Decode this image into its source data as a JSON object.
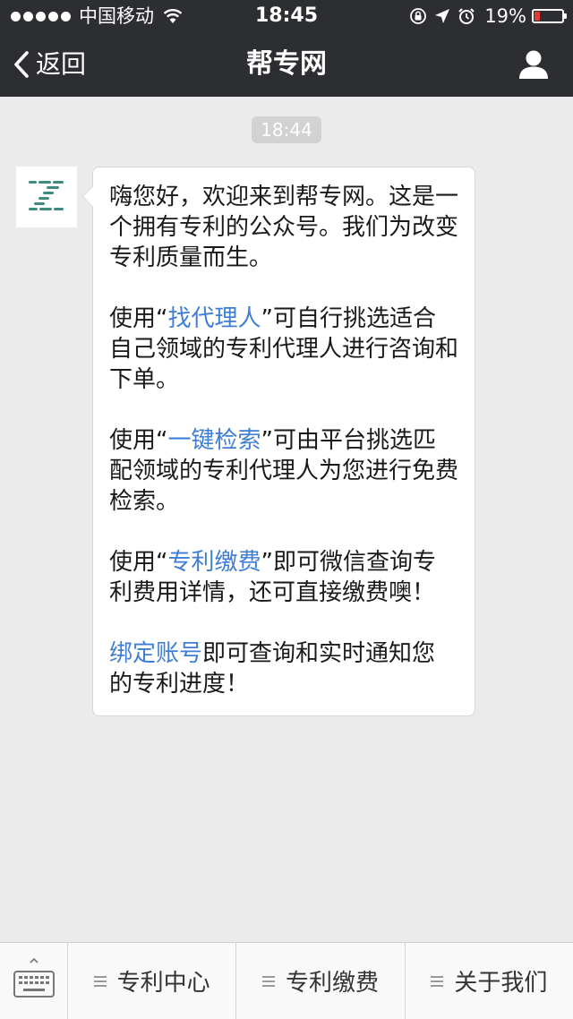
{
  "status_bar": {
    "carrier": "中国移动",
    "time": "18:45",
    "battery_percent": "19%",
    "battery_level": 0.19,
    "battery_color": "#e53935",
    "icons": [
      "signal-dots-icon",
      "wifi-icon",
      "orientation-lock-icon",
      "location-arrow-icon",
      "alarm-icon",
      "battery-icon"
    ]
  },
  "nav": {
    "back_label": "返回",
    "title": "帮专网",
    "back_icon": "chevron-left-icon",
    "profile_icon": "person-icon"
  },
  "chat": {
    "timestamp": "18:44",
    "avatar_icon": "bangzhuanwang-logo-icon",
    "message": {
      "p1": "嗨您好，欢迎来到帮专网。这是一个拥有专利的公众号。我们为改变专利质量而生。",
      "p2_prefix": "使用“",
      "p2_link": "找代理人",
      "p2_suffix": "”可自行挑选适合自己领域的专利代理人进行咨询和下单。",
      "p3_prefix": "使用“",
      "p3_link": "一键检索",
      "p3_suffix": "”可由平台挑选匹配领域的专利代理人为您进行免费检索。",
      "p4_prefix": "使用“",
      "p4_link": "专利缴费",
      "p4_suffix": "”即可微信查询专利费用详情，还可直接缴费噢！",
      "p5_link": "绑定账号",
      "p5_suffix": "即可查询和实时通知您的专利进度！"
    },
    "link_color": "#3e7ed4"
  },
  "bottom_menu": {
    "keyboard_icon": "keyboard-icon",
    "items": [
      {
        "label": "专利中心",
        "icon": "menu-lines-icon"
      },
      {
        "label": "专利缴费",
        "icon": "menu-lines-icon"
      },
      {
        "label": "关于我们",
        "icon": "menu-lines-icon"
      }
    ]
  }
}
